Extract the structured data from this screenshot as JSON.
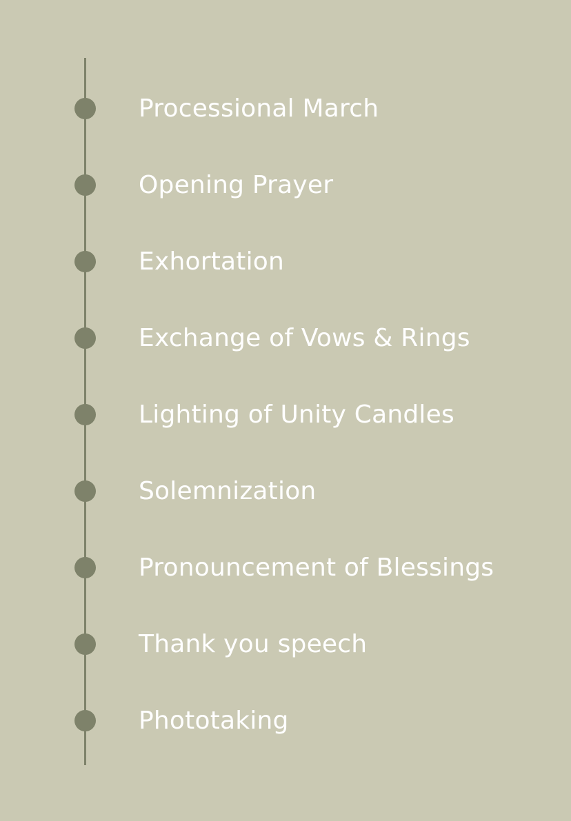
{
  "colors": {
    "background": "#cac9b3",
    "timeline_line": "#7e826a",
    "dot": "#7e826a",
    "text": "#ffffff"
  },
  "timeline": {
    "items": [
      {
        "label": "Processional March"
      },
      {
        "label": "Opening Prayer"
      },
      {
        "label": "Exhortation"
      },
      {
        "label": "Exchange of Vows & Rings"
      },
      {
        "label": "Lighting of Unity Candles"
      },
      {
        "label": "Solemnization"
      },
      {
        "label": "Pronouncement of Blessings"
      },
      {
        "label": "Thank you speech"
      },
      {
        "label": "Phototaking"
      }
    ]
  }
}
